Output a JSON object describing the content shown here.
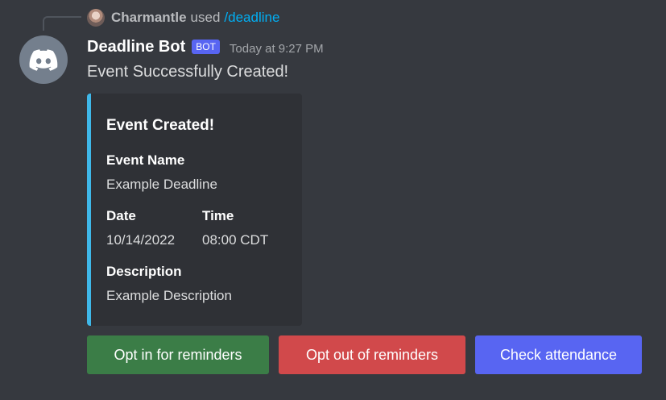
{
  "reply": {
    "username": "Charmantle",
    "used_text": "used",
    "command": "/deadline"
  },
  "author": {
    "name": "Deadline Bot",
    "tag": "BOT",
    "timestamp": "Today at 9:27 PM",
    "avatar_icon": "discord-logo-icon"
  },
  "message": {
    "content": "Event Successfully Created!"
  },
  "embed": {
    "accent_color": "#3fb8e9",
    "title": "Event Created!",
    "fields": {
      "event_name": {
        "name": "Event Name",
        "value": "Example Deadline"
      },
      "date": {
        "name": "Date",
        "value": "10/14/2022"
      },
      "time": {
        "name": "Time",
        "value": "08:00 CDT"
      },
      "description": {
        "name": "Description",
        "value": "Example Description"
      }
    }
  },
  "buttons": {
    "opt_in": {
      "label": "Opt in for reminders",
      "color": "#3b7d47"
    },
    "opt_out": {
      "label": "Opt out of reminders",
      "color": "#d1494b"
    },
    "attendance": {
      "label": "Check attendance",
      "color": "#5865f2"
    }
  },
  "colors": {
    "background": "#36393f",
    "embed_background": "#2f3136",
    "command_link": "#00aff4"
  }
}
